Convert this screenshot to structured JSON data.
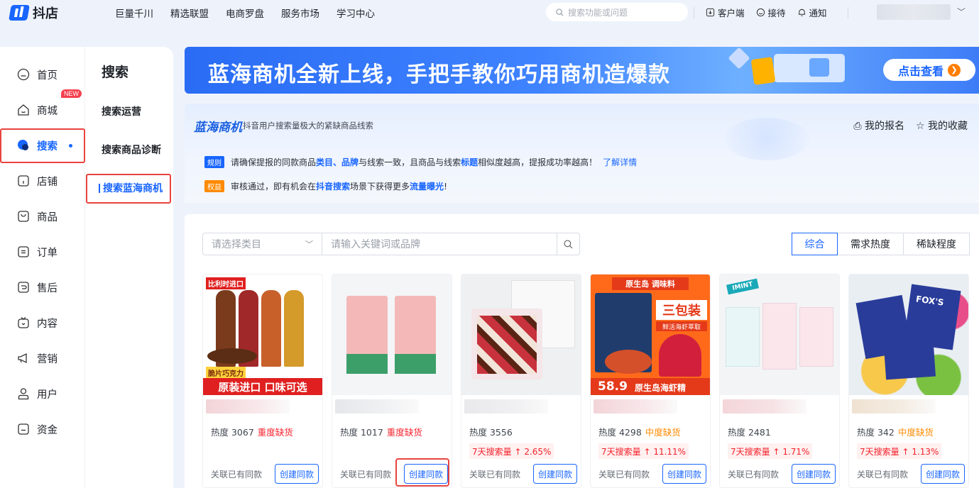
{
  "app": {
    "logo_text": "抖店"
  },
  "topnav": [
    "巨量千川",
    "精选联盟",
    "电商罗盘",
    "服务市场",
    "学习中心"
  ],
  "top_search": {
    "placeholder": "搜索功能或问题"
  },
  "top_right": {
    "client": "客户端",
    "reception": "接待",
    "notify": "通知"
  },
  "sidebar": {
    "primary": [
      {
        "label": "首页",
        "icon": "home-icon"
      },
      {
        "label": "商城",
        "icon": "mall-icon",
        "badge": "NEW"
      },
      {
        "label": "搜索",
        "icon": "search-nav-icon",
        "active": true
      },
      {
        "label": "店铺",
        "icon": "store-icon"
      },
      {
        "label": "商品",
        "icon": "product-icon"
      },
      {
        "label": "订单",
        "icon": "order-icon"
      },
      {
        "label": "售后",
        "icon": "aftersale-icon"
      },
      {
        "label": "内容",
        "icon": "content-icon"
      },
      {
        "label": "营销",
        "icon": "marketing-icon"
      },
      {
        "label": "用户",
        "icon": "user-icon"
      },
      {
        "label": "资金",
        "icon": "wallet-icon"
      }
    ],
    "secondary_title": "搜索",
    "secondary": [
      {
        "label": "搜索运营"
      },
      {
        "label": "搜索商品诊断"
      },
      {
        "label": "搜索蓝海商机",
        "active": true
      }
    ]
  },
  "banner": {
    "headline": "蓝海商机全新上线，手把手教你巧用商机造爆款",
    "cta": "点击查看"
  },
  "info": {
    "title": "蓝海商机",
    "subtitle": "抖音用户搜索量极大的紧缺商品线索",
    "my_signup": "我的报名",
    "my_favorites": "我的收藏",
    "rule_tag": "规则",
    "rule_parts": [
      "请确保提报的同款商品",
      "类目",
      "、",
      "品牌",
      "与线索一致，且商品与线索",
      "标题",
      "相似度越高，提报成功率越高！"
    ],
    "rule_link": "了解详情",
    "benefit_tag": "权益",
    "benefit_parts": [
      "审核通过，即有机会在",
      "抖音搜索",
      "场景下获得更多",
      "流量曝光",
      "!"
    ]
  },
  "filters": {
    "category_placeholder": "请选择类目",
    "keyword_placeholder": "请输入关键词或品牌",
    "sort_options": [
      "综合",
      "需求热度",
      "稀缺程度"
    ],
    "sort_active": "综合"
  },
  "cards": [
    {
      "heat": "热度 3067",
      "shortage": "重度缺货",
      "shortage_level": "red",
      "trend": "",
      "related": "关联已有同款",
      "action": "创建同款",
      "img_text1": "比利时进口",
      "img_text2": "脆片巧克力",
      "img_text3": "原装进口 口味可选"
    },
    {
      "heat": "热度 1017",
      "shortage": "重度缺货",
      "shortage_level": "red",
      "trend": "",
      "related": "关联已有同款",
      "action": "创建同款"
    },
    {
      "heat": "热度 3556",
      "shortage": "",
      "shortage_level": "",
      "trend": "7天搜索量 ↑ 2.65%",
      "related": "关联已有同款",
      "action": "创建同款"
    },
    {
      "heat": "热度 4298",
      "shortage": "中度缺货",
      "shortage_level": "orange",
      "trend": "7天搜索量 ↑ 11.11%",
      "related": "关联已有同款",
      "action": "创建同款",
      "img_text1": "原生岛  调味料",
      "img_text2": "三包装",
      "img_text3": "鲜活海虾萃取",
      "img_text4": "58.9",
      "img_text5": "原生岛海虾精"
    },
    {
      "heat": "热度 2481",
      "shortage": "",
      "shortage_level": "",
      "trend": "7天搜索量 ↑ 1.71%",
      "related": "关联已有同款",
      "action": "创建同款",
      "img_text1": "IMINT"
    },
    {
      "heat": "热度 342",
      "shortage": "中度缺货",
      "shortage_level": "orange",
      "trend": "7天搜索量 ↑ 1.13%",
      "related": "关联已有同款",
      "action": "创建同款",
      "img_text1": "FOX'S"
    }
  ],
  "colors": {
    "accent": "#1966ff",
    "highlight_box": "#e8443f",
    "danger": "#f5222d",
    "warning": "#ff8a00"
  }
}
